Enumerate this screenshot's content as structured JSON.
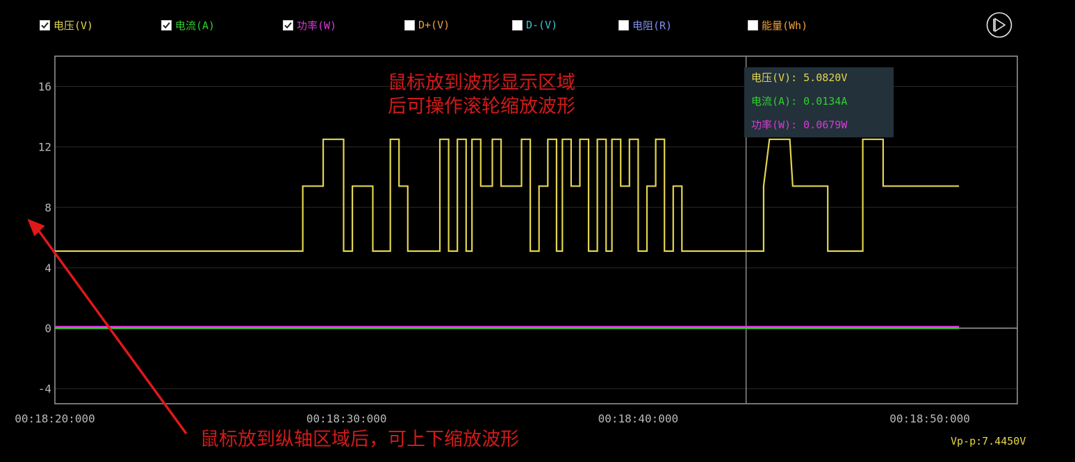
{
  "legend": [
    {
      "label": "电压(V)",
      "checked": true,
      "color": "#e3d64e"
    },
    {
      "label": "电流(A)",
      "checked": true,
      "color": "#2fd12f"
    },
    {
      "label": "功率(W)",
      "checked": true,
      "color": "#d83ad8"
    },
    {
      "label": "D+(V)",
      "checked": false,
      "color": "#f0a13a"
    },
    {
      "label": "D-(V)",
      "checked": false,
      "color": "#38c6d6"
    },
    {
      "label": "电阻(R)",
      "checked": false,
      "color": "#7f92ee"
    },
    {
      "label": "能量(Wh)",
      "checked": false,
      "color": "#f0a13a"
    }
  ],
  "play_button_icon": "play-icon",
  "annotations": {
    "top_line1": "鼠标放到波形显示区域",
    "top_line2": "后可操作滚轮缩放波形",
    "bottom": "鼠标放到纵轴区域后，可上下缩放波形"
  },
  "tooltip": {
    "voltage": "电压(V): 5.0820V",
    "current": "电流(A): 0.0134A",
    "power": "功率(W): 0.0679W"
  },
  "vpp": "Vp-p:7.4450V",
  "chart_data": {
    "type": "line",
    "ylim": [
      -5,
      18
    ],
    "yticks": [
      -4,
      0,
      4,
      8,
      12,
      16
    ],
    "xlim": [
      "00:18:20:000",
      "00:18:53:000"
    ],
    "xticks": [
      "00:18:20:000",
      "00:18:30:000",
      "00:18:40:000",
      "00:18:50:000"
    ],
    "cursor_x": "00:18:43:700",
    "series": [
      {
        "name": "电压(V)",
        "color": "#e3d64e",
        "values": [
          [
            20.0,
            5.1
          ],
          [
            28.5,
            5.1
          ],
          [
            28.5,
            9.4
          ],
          [
            29.2,
            9.4
          ],
          [
            29.2,
            12.5
          ],
          [
            29.9,
            12.5
          ],
          [
            29.9,
            5.1
          ],
          [
            30.2,
            5.1
          ],
          [
            30.2,
            9.4
          ],
          [
            30.9,
            9.4
          ],
          [
            30.9,
            5.1
          ],
          [
            31.5,
            5.1
          ],
          [
            31.5,
            12.5
          ],
          [
            31.8,
            12.5
          ],
          [
            31.8,
            9.4
          ],
          [
            32.1,
            9.4
          ],
          [
            32.1,
            5.1
          ],
          [
            33.2,
            5.1
          ],
          [
            33.2,
            12.5
          ],
          [
            33.5,
            12.5
          ],
          [
            33.5,
            5.1
          ],
          [
            33.8,
            5.1
          ],
          [
            33.8,
            12.5
          ],
          [
            34.1,
            12.5
          ],
          [
            34.1,
            5.1
          ],
          [
            34.3,
            5.1
          ],
          [
            34.3,
            12.5
          ],
          [
            34.6,
            12.5
          ],
          [
            34.6,
            9.4
          ],
          [
            35.0,
            9.4
          ],
          [
            35.0,
            12.5
          ],
          [
            35.3,
            12.5
          ],
          [
            35.3,
            9.4
          ],
          [
            36.0,
            9.4
          ],
          [
            36.0,
            12.5
          ],
          [
            36.3,
            12.5
          ],
          [
            36.3,
            5.1
          ],
          [
            36.6,
            5.1
          ],
          [
            36.6,
            9.4
          ],
          [
            36.9,
            9.4
          ],
          [
            36.9,
            12.5
          ],
          [
            37.2,
            12.5
          ],
          [
            37.2,
            5.1
          ],
          [
            37.4,
            5.1
          ],
          [
            37.4,
            12.5
          ],
          [
            37.7,
            12.5
          ],
          [
            37.7,
            9.4
          ],
          [
            38.0,
            9.4
          ],
          [
            38.0,
            12.5
          ],
          [
            38.3,
            12.5
          ],
          [
            38.3,
            5.1
          ],
          [
            38.6,
            5.1
          ],
          [
            38.6,
            12.5
          ],
          [
            38.9,
            12.5
          ],
          [
            38.9,
            5.1
          ],
          [
            39.1,
            5.1
          ],
          [
            39.1,
            12.5
          ],
          [
            39.4,
            12.5
          ],
          [
            39.4,
            9.4
          ],
          [
            39.7,
            9.4
          ],
          [
            39.7,
            12.5
          ],
          [
            40.0,
            12.5
          ],
          [
            40.0,
            5.1
          ],
          [
            40.3,
            5.1
          ],
          [
            40.3,
            9.4
          ],
          [
            40.6,
            9.4
          ],
          [
            40.6,
            12.5
          ],
          [
            40.9,
            12.5
          ],
          [
            40.9,
            5.1
          ],
          [
            41.2,
            5.1
          ],
          [
            41.2,
            9.4
          ],
          [
            41.5,
            9.4
          ],
          [
            41.5,
            5.1
          ],
          [
            43.8,
            5.1
          ],
          [
            44.3,
            5.1
          ],
          [
            44.3,
            9.4
          ],
          [
            44.5,
            12.5
          ],
          [
            45.2,
            12.5
          ],
          [
            45.3,
            9.4
          ],
          [
            46.5,
            9.4
          ],
          [
            46.5,
            5.1
          ],
          [
            47.7,
            5.1
          ],
          [
            47.7,
            12.5
          ],
          [
            48.4,
            12.5
          ],
          [
            48.4,
            9.4
          ],
          [
            51.0,
            9.4
          ]
        ]
      },
      {
        "name": "电流(A)",
        "color": "#2fd12f",
        "values": [
          [
            20.0,
            0.0
          ],
          [
            51.0,
            0.0
          ]
        ]
      },
      {
        "name": "功率(W)",
        "color": "#d83ad8",
        "values": [
          [
            20.0,
            0.1
          ],
          [
            51.0,
            0.1
          ]
        ]
      }
    ]
  }
}
